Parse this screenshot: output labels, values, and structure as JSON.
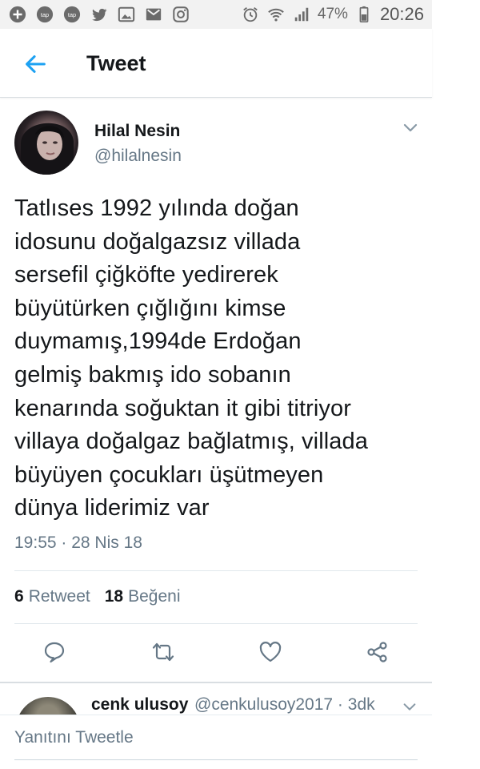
{
  "status_bar": {
    "battery": "47%",
    "time": "20:26",
    "left_icons": [
      "plus-icon",
      "tap-app-icon",
      "tap-app-icon",
      "twitter-icon",
      "image-icon",
      "gmail-icon",
      "instagram-icon"
    ],
    "right_icons": [
      "alarm-icon",
      "wifi-icon",
      "signal-icon",
      "battery-icon"
    ],
    "tap_label": "tap"
  },
  "header": {
    "title": "Tweet",
    "accent": "#1da1f2"
  },
  "tweet": {
    "author_name": "Hilal Nesin",
    "author_handle": "@hilalnesin",
    "text": "Tatlıses 1992 yılında doğan\nidosunu doğalgazsız villada\nsersefil çiğköfte yedirerek\nbüyütürken çığlığını kimse\nduymamış,1994de Erdoğan\ngelmiş bakmış ido sobanın\nkenarında soğuktan it gibi titriyor\nvillaya doğalgaz bağlatmış, villada\nbüyüyen çocukları üşütmeyen\ndünya liderimiz var",
    "timestamp": "19:55 · 28 Nis 18",
    "retweets_count": "6",
    "retweets_label": "Retweet",
    "likes_count": "18",
    "likes_label": "Beğeni"
  },
  "actions": [
    "reply-icon",
    "retweet-icon",
    "like-icon",
    "share-icon"
  ],
  "reply": {
    "name": "cenk ulusoy",
    "meta": "@cenkulusoy2017 · 3dk"
  },
  "compose": {
    "placeholder": "Yanıtını Tweetle"
  }
}
